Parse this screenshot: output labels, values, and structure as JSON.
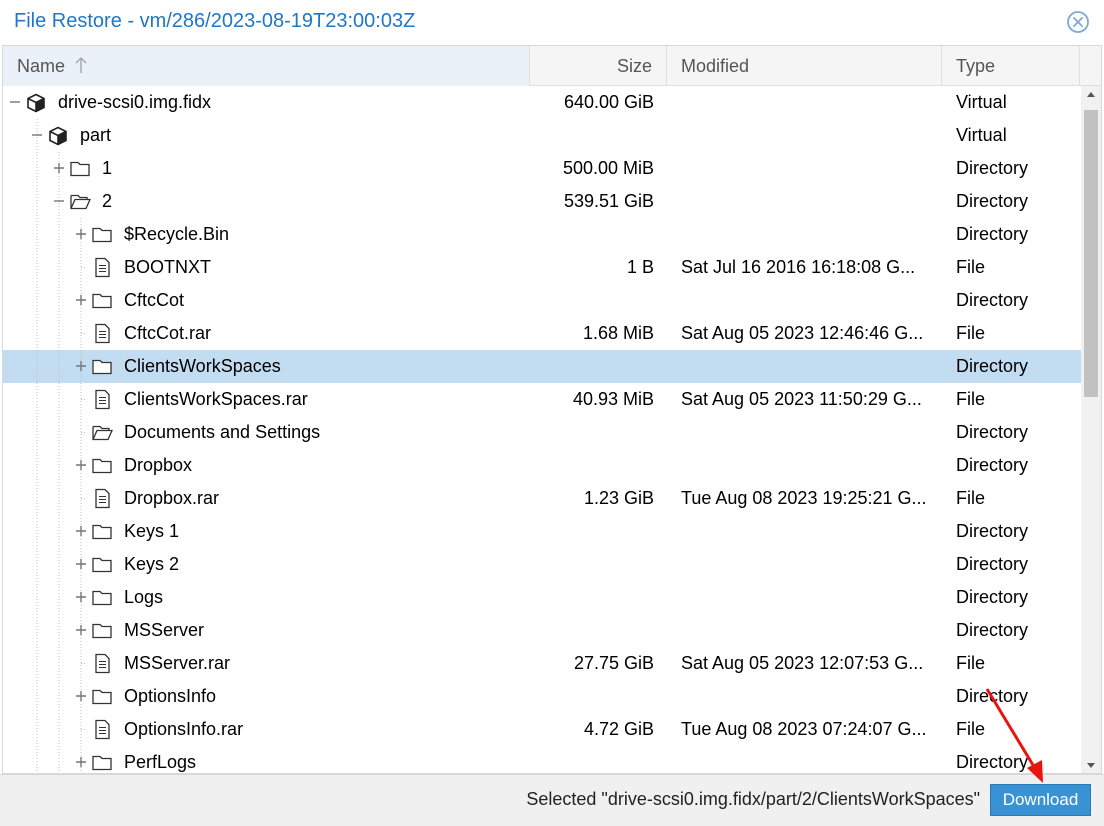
{
  "dialog": {
    "title": "File Restore - vm/286/2023-08-19T23:00:03Z",
    "close_icon": "close-circle-icon"
  },
  "columns": {
    "name": "Name",
    "size": "Size",
    "modified": "Modified",
    "type": "Type",
    "sort_icon": "sort-ascending-arrow-icon"
  },
  "rows": [
    {
      "depth": 0,
      "expander": "minus",
      "icon": "cube-icon",
      "name": "drive-scsi0.img.fidx",
      "size": "640.00 GiB",
      "modified": "",
      "type": "Virtual"
    },
    {
      "depth": 1,
      "expander": "minus",
      "icon": "cube-icon",
      "name": "part",
      "size": "",
      "modified": "",
      "type": "Virtual"
    },
    {
      "depth": 2,
      "expander": "plus",
      "icon": "folder-icon",
      "name": "1",
      "size": "500.00 MiB",
      "modified": "",
      "type": "Directory"
    },
    {
      "depth": 2,
      "expander": "minus",
      "icon": "folder-open-icon",
      "name": "2",
      "size": "539.51 GiB",
      "modified": "",
      "type": "Directory"
    },
    {
      "depth": 3,
      "expander": "plus",
      "icon": "folder-icon",
      "name": "$Recycle.Bin",
      "size": "",
      "modified": "",
      "type": "Directory"
    },
    {
      "depth": 3,
      "expander": "none",
      "icon": "file-icon",
      "name": "BOOTNXT",
      "size": "1 B",
      "modified": "Sat Jul 16 2016 16:18:08 G...",
      "type": "File"
    },
    {
      "depth": 3,
      "expander": "plus",
      "icon": "folder-icon",
      "name": "CftcCot",
      "size": "",
      "modified": "",
      "type": "Directory"
    },
    {
      "depth": 3,
      "expander": "none",
      "icon": "file-icon",
      "name": "CftcCot.rar",
      "size": "1.68 MiB",
      "modified": "Sat Aug 05 2023 12:46:46 G...",
      "type": "File"
    },
    {
      "depth": 3,
      "expander": "plus",
      "icon": "folder-icon",
      "name": "ClientsWorkSpaces",
      "size": "",
      "modified": "",
      "type": "Directory",
      "selected": true
    },
    {
      "depth": 3,
      "expander": "none",
      "icon": "file-icon",
      "name": "ClientsWorkSpaces.rar",
      "size": "40.93 MiB",
      "modified": "Sat Aug 05 2023 11:50:29 G...",
      "type": "File"
    },
    {
      "depth": 3,
      "expander": "none",
      "icon": "folder-open-icon",
      "name": "Documents and Settings",
      "size": "",
      "modified": "",
      "type": "Directory"
    },
    {
      "depth": 3,
      "expander": "plus",
      "icon": "folder-icon",
      "name": "Dropbox",
      "size": "",
      "modified": "",
      "type": "Directory"
    },
    {
      "depth": 3,
      "expander": "none",
      "icon": "file-icon",
      "name": "Dropbox.rar",
      "size": "1.23 GiB",
      "modified": "Tue Aug 08 2023 19:25:21 G...",
      "type": "File"
    },
    {
      "depth": 3,
      "expander": "plus",
      "icon": "folder-icon",
      "name": "Keys 1",
      "size": "",
      "modified": "",
      "type": "Directory"
    },
    {
      "depth": 3,
      "expander": "plus",
      "icon": "folder-icon",
      "name": "Keys 2",
      "size": "",
      "modified": "",
      "type": "Directory"
    },
    {
      "depth": 3,
      "expander": "plus",
      "icon": "folder-icon",
      "name": "Logs",
      "size": "",
      "modified": "",
      "type": "Directory"
    },
    {
      "depth": 3,
      "expander": "plus",
      "icon": "folder-icon",
      "name": "MSServer",
      "size": "",
      "modified": "",
      "type": "Directory"
    },
    {
      "depth": 3,
      "expander": "none",
      "icon": "file-icon",
      "name": "MSServer.rar",
      "size": "27.75 GiB",
      "modified": "Sat Aug 05 2023 12:07:53 G...",
      "type": "File"
    },
    {
      "depth": 3,
      "expander": "plus",
      "icon": "folder-icon",
      "name": "OptionsInfo",
      "size": "",
      "modified": "",
      "type": "Directory"
    },
    {
      "depth": 3,
      "expander": "none",
      "icon": "file-icon",
      "name": "OptionsInfo.rar",
      "size": "4.72 GiB",
      "modified": "Tue Aug 08 2023 07:24:07 G...",
      "type": "File"
    },
    {
      "depth": 3,
      "expander": "plus",
      "icon": "folder-icon",
      "name": "PerfLogs",
      "size": "",
      "modified": "",
      "type": "Directory"
    }
  ],
  "footer": {
    "status": "Selected \"drive-scsi0.img.fidx/part/2/ClientsWorkSpaces\"",
    "download_label": "Download"
  },
  "annotation": {
    "arrow_color": "#e8150f"
  },
  "colors": {
    "title": "#1f77c7",
    "selected_row": "#c2dcf2",
    "button": "#3892d4"
  }
}
